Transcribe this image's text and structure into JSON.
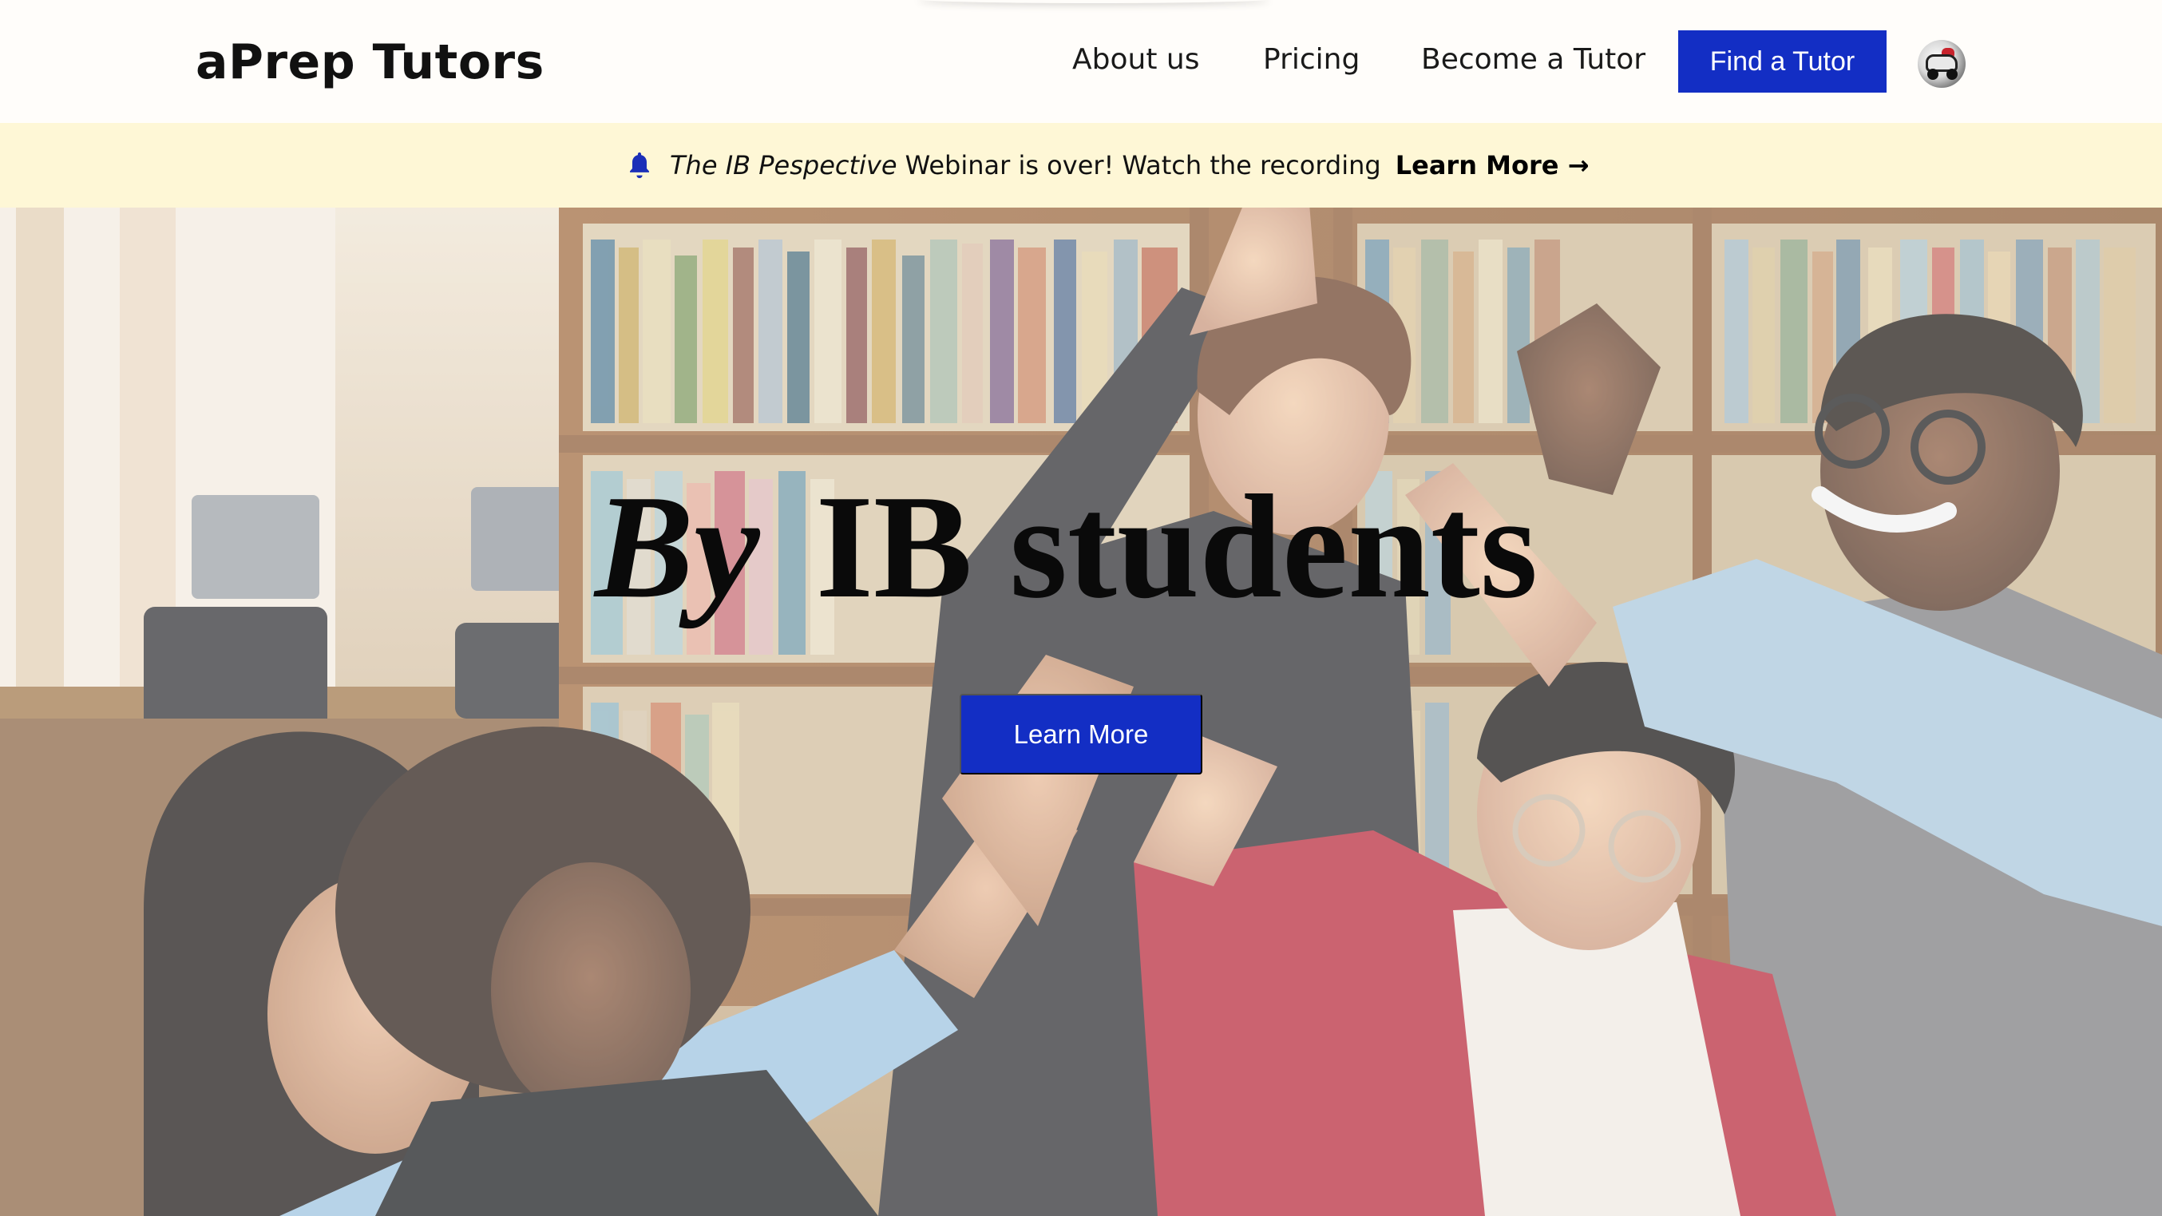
{
  "header": {
    "brand": "aPrep Tutors",
    "nav": {
      "about": "About us",
      "pricing": "Pricing",
      "become_tutor": "Become a Tutor"
    },
    "cta_label": "Find a Tutor",
    "avatar_icon": "profile-avatar-car-icon"
  },
  "banner": {
    "icon": "bell-icon",
    "em_text": "The IB Pespective",
    "text": "Webinar is over! Watch the recording",
    "link": "Learn More →"
  },
  "hero": {
    "title_em": "By",
    "title": "IB students",
    "cta_label": "Learn More"
  },
  "colors": {
    "accent": "#132ec4",
    "banner_bg": "#fef7d6",
    "page_bg": "#fffdfa"
  }
}
